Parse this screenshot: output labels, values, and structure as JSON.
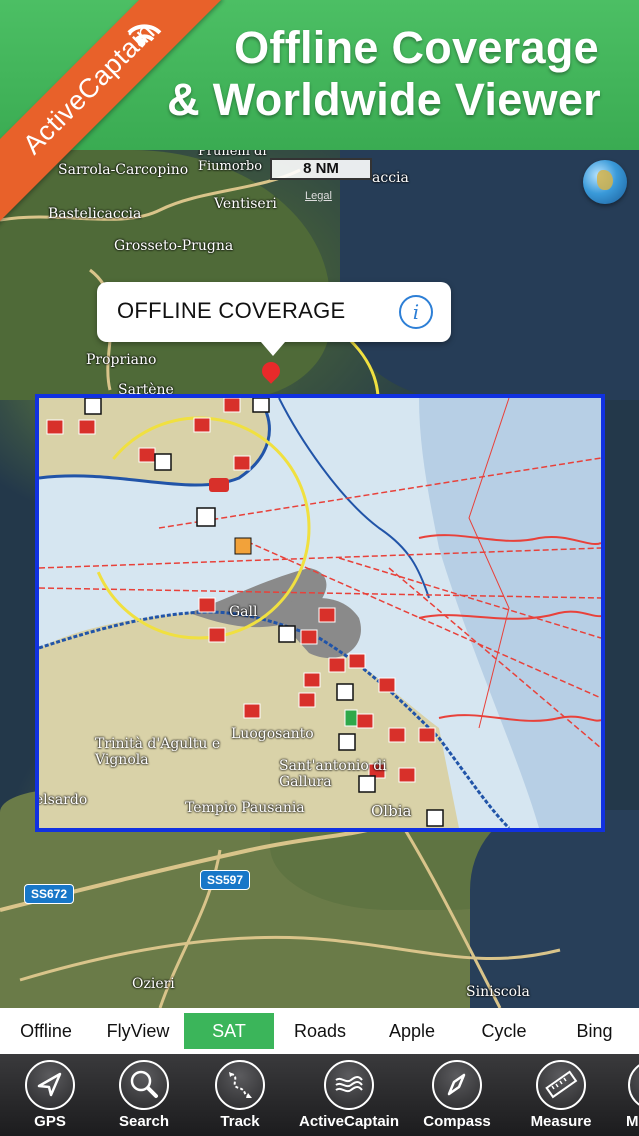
{
  "header": {
    "line1": "Offline Coverage",
    "line2": "& Worldwide Viewer",
    "ribbon_text": "ActiveCaptain",
    "background": "#3fb157",
    "ribbon_color": "#e8612a"
  },
  "map": {
    "scale_label": "8 NM",
    "legal_label": "Legal",
    "callout_text": "OFFLINE COVERAGE",
    "coverage_border_color": "#1131e0",
    "places": [
      "Prunelli di Fiumorbo",
      "Sarrola-Carcopino",
      "Bastelicaccia",
      "Ventiseri",
      "Grosseto-Prugna",
      "Propriano",
      "Sartène",
      "Trinità d'Agultu e Vignola",
      "Luogosanto",
      "Sant'antonio di Gallura",
      "Castelsardo",
      "Tempio Pausania",
      "Olbia",
      "Ozieri",
      "Siniscola",
      "accia",
      "Gall"
    ],
    "road_signs": [
      "SS672",
      "SS597"
    ]
  },
  "map_types": {
    "items": [
      "Offline",
      "FlyView",
      "SAT",
      "Roads",
      "Apple",
      "Cycle",
      "Bing"
    ],
    "active": "SAT",
    "active_color": "#3bb55a"
  },
  "toolbar": {
    "items": [
      {
        "label": "GPS",
        "icon": "location-arrow-icon"
      },
      {
        "label": "Search",
        "icon": "magnifier-icon"
      },
      {
        "label": "Track",
        "icon": "track-icon"
      },
      {
        "label": "ActiveCaptain",
        "icon": "activecaptain-waves-icon"
      },
      {
        "label": "Compass",
        "icon": "compass-icon"
      },
      {
        "label": "Measure",
        "icon": "ruler-icon"
      },
      {
        "label": "M",
        "icon": "more-icon"
      }
    ]
  }
}
